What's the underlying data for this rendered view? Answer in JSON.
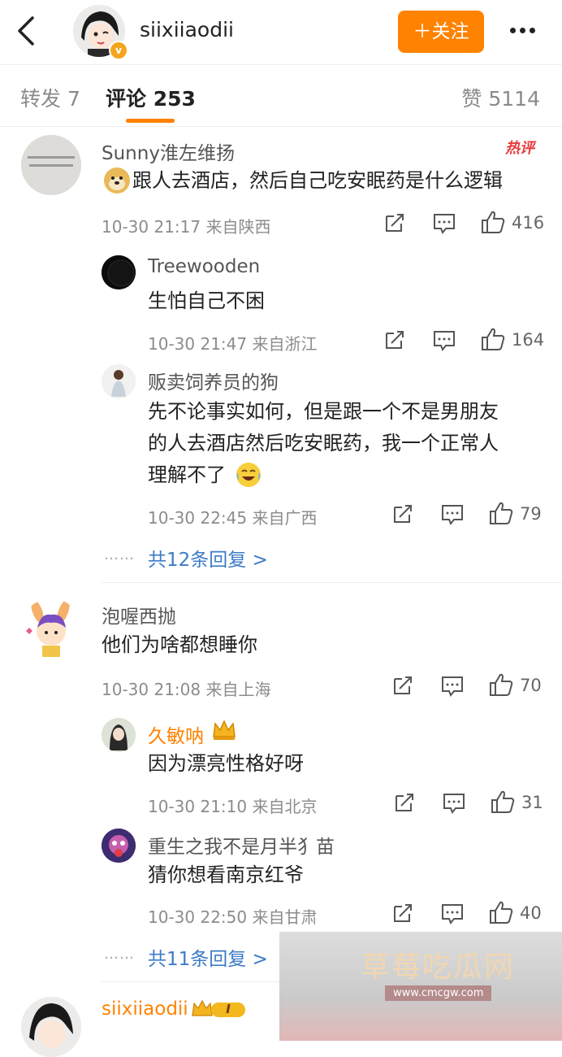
{
  "header": {
    "username": "siixiiaodii",
    "verified_badge": "v",
    "follow_label": "＋关注",
    "back_icon": "chevron-left",
    "more_icon": "ellipsis"
  },
  "tabs": {
    "forward": "转发 7",
    "comments": "评论 253",
    "likes": "赞 5114"
  },
  "hot_label": "热评",
  "comments": [
    {
      "nick": "Sunny淮左维扬",
      "text": "跟人去酒店，然后自己吃安眠药是什么逻辑",
      "emoji": "doge",
      "meta": "10-30 21:17  来自陕西",
      "likes": "416",
      "replies": [
        {
          "nick": "Treewooden",
          "text": "生怕自己不困",
          "meta": "10-30 21:47  来自浙江",
          "likes": "164"
        },
        {
          "nick": "贩卖饲养员的狗",
          "text_lines": [
            "先不论事实如何，但是跟一个不是男朋友",
            "的人去酒店然后吃安眠药，我一个正常人",
            "理解不了"
          ],
          "emoji": "laugh-cry",
          "meta": "10-30 22:45  来自广西",
          "likes": "79"
        }
      ],
      "more_replies": "共12条回复 >"
    },
    {
      "nick": "泡喔西抛",
      "text": "他们为啥都想睡你",
      "meta": "10-30 21:08  来自上海",
      "likes": "70",
      "replies": [
        {
          "nick": "久敏呐",
          "badge": "crown",
          "text": "因为漂亮性格好呀",
          "meta": "10-30 21:10  来自北京",
          "likes": "31"
        },
        {
          "nick": "重生之我不是月半犭苗",
          "text": "猜你想看南京红爷",
          "meta": "10-30 22:50  来自甘肃",
          "likes": "40"
        }
      ],
      "more_replies": "共11条回复 >"
    },
    {
      "nick": "siixiiaodii",
      "badge": "I"
    }
  ],
  "watermark": {
    "title": "草莓吃瓜网",
    "url": "www.cmcgw.com"
  },
  "colors": {
    "accent": "#ff8200",
    "link": "#3c7bc7",
    "hot": "#e73b3b"
  }
}
